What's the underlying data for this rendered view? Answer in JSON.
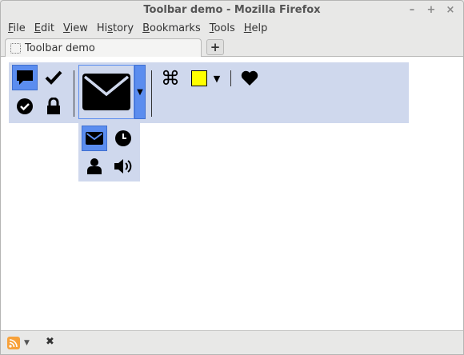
{
  "window": {
    "title": "Toolbar demo - Mozilla Firefox",
    "controls": {
      "minimize": "–",
      "maximize": "+",
      "close": "×"
    }
  },
  "menubar": {
    "items": [
      {
        "label": "File",
        "mnemonic": "F",
        "rest": "ile"
      },
      {
        "label": "Edit",
        "mnemonic": "E",
        "rest": "dit"
      },
      {
        "label": "View",
        "mnemonic": "V",
        "rest": "iew"
      },
      {
        "label": "History",
        "mnemonic": "",
        "pre": "Hi",
        "mn": "s",
        "rest": "tory"
      },
      {
        "label": "Bookmarks",
        "mnemonic": "B",
        "rest": "ookmarks"
      },
      {
        "label": "Tools",
        "mnemonic": "T",
        "rest": "ools"
      },
      {
        "label": "Help",
        "mnemonic": "H",
        "rest": "elp"
      }
    ]
  },
  "tabs": [
    {
      "label": "Toolbar demo",
      "active": true
    }
  ],
  "newtab": {
    "label": "+"
  },
  "toolbar": {
    "small_grid": [
      "comment-icon",
      "checkmark-icon",
      "check-circle-icon",
      "lock-icon"
    ],
    "big_button": "envelope-icon",
    "dropdown_arrow": "▼",
    "command": "⌘",
    "color_swatch": "#ffff00",
    "heart": "heart-icon"
  },
  "popup": {
    "items": [
      "envelope-icon",
      "clock-icon",
      "user-icon",
      "volume-icon"
    ]
  },
  "colors": {
    "toolbar_bg": "#cfd8ed",
    "selected_bg": "#5b8def",
    "swatch": "#ffff00"
  },
  "statusbar": {
    "rss_icon": "rss-icon",
    "arrow": "▼",
    "close": "✖"
  }
}
